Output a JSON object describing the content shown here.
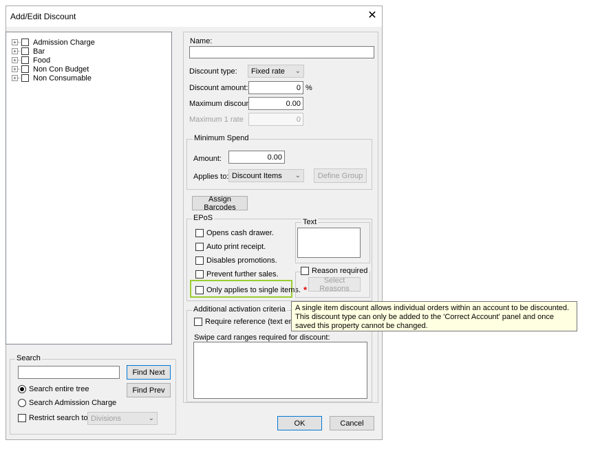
{
  "window": {
    "title": "Add/Edit Discount",
    "close_glyph": "✕"
  },
  "tree": {
    "items": [
      {
        "label": "Admission Charge"
      },
      {
        "label": "Bar"
      },
      {
        "label": "Food"
      },
      {
        "label": "Non Con Budget"
      },
      {
        "label": "Non Consumable"
      }
    ],
    "expander_glyph": "+"
  },
  "search": {
    "group_label": "Search",
    "input_value": "",
    "find_next": "Find Next",
    "find_prev": "Find Prev",
    "option_entire_tree": "Search entire tree",
    "option_admission": "Search Admission Charge",
    "selected_option": "Search entire tree",
    "restrict_label": "Restrict search to",
    "restrict_select": "Divisions"
  },
  "form": {
    "name_label": "Name:",
    "name_value": "",
    "discount_type_label": "Discount type:",
    "discount_type_value": "Fixed rate",
    "discount_amount_label": "Discount amount:",
    "discount_amount_value": "0",
    "discount_amount_unit": "%",
    "maximum_discount_label": "Maximum discount:",
    "maximum_discount_value": "0.00",
    "maximum_rate_label": "Maximum 1 rate",
    "maximum_rate_value": "0"
  },
  "minimum_spend": {
    "group_label": "Minimum Spend",
    "amount_label": "Amount:",
    "amount_value": "0.00",
    "applies_to_label": "Applies to:",
    "applies_to_value": "Discount Items",
    "define_group": "Define Group"
  },
  "assign_barcodes": "Assign Barcodes",
  "epos": {
    "group_label": "EPoS",
    "options": [
      {
        "label": "Opens cash drawer."
      },
      {
        "label": "Auto print receipt."
      },
      {
        "label": "Disables promotions."
      },
      {
        "label": "Prevent further sales."
      },
      {
        "label": "Only applies to single items."
      }
    ],
    "required_marker": "*",
    "text_group_label": "Text",
    "reason_required_label": "Reason required",
    "select_reasons": "Select Reasons"
  },
  "activation": {
    "group_label": "Additional activation criteria",
    "require_reference_label": "Require reference (text entry c",
    "swipe_label": "Swipe card ranges required for discount:"
  },
  "tooltip": {
    "text": "A single item discount allows individual orders within an account to be discounted. This discount type can only be added to the 'Correct Account' panel and once saved this property cannot be changed."
  },
  "footer": {
    "ok": "OK",
    "cancel": "Cancel"
  },
  "colors": {
    "highlight": "#9acd32",
    "tooltip_bg": "#ffffe1",
    "accent_border": "#0078d7"
  }
}
